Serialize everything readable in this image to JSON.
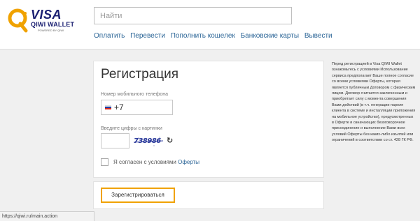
{
  "header": {
    "logo": {
      "brand": "VISA",
      "product": "QIWI WALLET",
      "tagline": "POWERED BY QIWI"
    },
    "search": {
      "placeholder": "Найти",
      "value": ""
    },
    "nav": [
      "Оплатить",
      "Перевести",
      "Пополнить кошелек",
      "Банковские карты",
      "Вывести"
    ]
  },
  "registration": {
    "title": "Регистрация",
    "phone_label": "Номер мобильного телефона",
    "phone_code": "+7",
    "captcha_label": "Введите цифры с картинки",
    "captcha_text": "738986",
    "agree_text": "Я согласен с условиями",
    "agree_link": "Оферты",
    "register_button": "Зарегистрироваться"
  },
  "terms_text": "Перед регистрацией в Visa QIWI Wallet ознакомьтесь с условиями Использование сервиса предполагает Ваше полное согласие со всеми условиями Оферты, которая является публичным Договором с физическим лицом. Договор считается заключенным и приобретает силу с момента совершения Вами действий (в т.ч. генерации пароля клиента в системе и инсталляции приложения на мобильное устройство), предусмотренных в Оферте и означающих безоговорочное присоединение и выполнение Вами всех условий Оферты без каких-либо изъятий или ограничений в соответствии со ст. 428 ГК РФ.",
  "status_bar": "https://qiwi.ru/main.action",
  "colors": {
    "accent": "#f0a200",
    "link": "#2a6496",
    "brand_blue": "#1a1f71",
    "background": "#f0f0f0"
  },
  "icons": {
    "logo": "qiwi-q-logo-icon",
    "flag": "russia-flag-icon",
    "refresh": "refresh-icon"
  }
}
